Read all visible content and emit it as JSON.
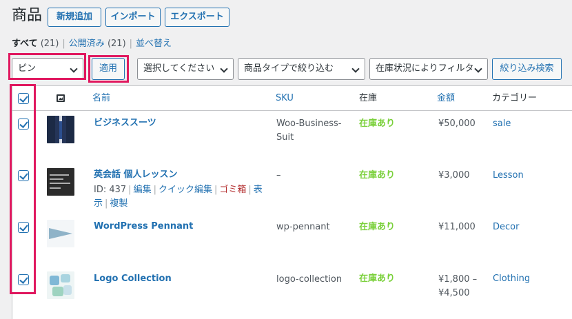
{
  "header": {
    "title": "商品",
    "add_new": "新規追加",
    "import": "インポート",
    "export": "エクスポート"
  },
  "views": {
    "all": {
      "label": "すべて",
      "count": "(21)"
    },
    "published": {
      "label": "公開済み",
      "count": "(21)"
    },
    "sort": {
      "label": "並べ替え"
    }
  },
  "controls": {
    "bulk_action": "ピン",
    "apply": "適用",
    "category_filter": "選択してください",
    "type_filter": "商品タイプで絞り込む",
    "stock_filter": "在庫状況によりフィルタ",
    "filter_button": "絞り込み検索"
  },
  "table": {
    "headers": {
      "name": "名前",
      "sku": "SKU",
      "stock": "在庫",
      "price": "金額",
      "category": "カテゴリー"
    },
    "rows": [
      {
        "name": "ビジネススーツ",
        "sku": "Woo-Business-Suit",
        "stock": "在庫あり",
        "price": "¥50,000",
        "category": "sale"
      },
      {
        "name": "英会話 個人レッスン",
        "sku": "–",
        "stock": "在庫あり",
        "price": "¥3,000",
        "category": "Lesson"
      },
      {
        "name": "WordPress Pennant",
        "sku": "wp-pennant",
        "stock": "在庫あり",
        "price": "¥11,000",
        "category": "Decor"
      },
      {
        "name": "Logo Collection",
        "sku": "logo-collection",
        "stock": "在庫あり",
        "price": "¥1,800 –\n¥4,500",
        "category": "Clothing"
      }
    ],
    "row_actions": {
      "id": "ID: 437",
      "edit": "編集",
      "quick_edit": "クイック編集",
      "trash": "ゴミ箱",
      "view": "表示",
      "duplicate": "複製"
    }
  },
  "colors": {
    "accent": "#2271b1",
    "highlight": "#e0185f",
    "in_stock": "#7ad03a",
    "trash": "#b32d2e"
  }
}
